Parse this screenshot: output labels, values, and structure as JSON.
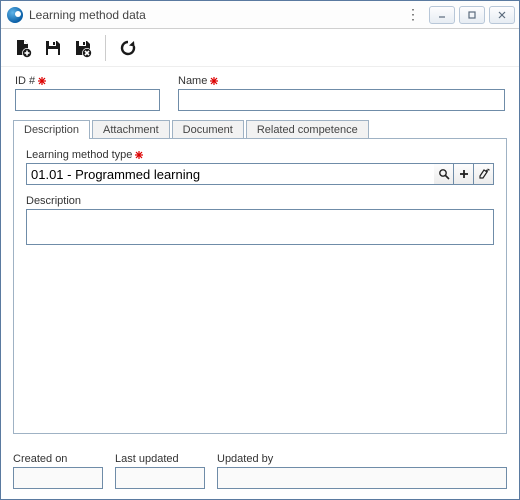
{
  "window": {
    "title": "Learning method data"
  },
  "toolbar": {
    "new": "new-record",
    "save": "save-record",
    "delete": "delete-record",
    "refresh": "refresh"
  },
  "fields": {
    "id_label": "ID #",
    "id_value": "",
    "name_label": "Name",
    "name_value": ""
  },
  "tabs": {
    "description": "Description",
    "attachment": "Attachment",
    "document": "Document",
    "related": "Related competence"
  },
  "desc_tab": {
    "type_label": "Learning method type",
    "type_value": "01.01 - Programmed learning",
    "desc_label": "Description",
    "desc_value": ""
  },
  "footer": {
    "created_label": "Created on",
    "created_value": "",
    "updated_label": "Last updated",
    "updated_value": "",
    "by_label": "Updated by",
    "by_value": ""
  }
}
